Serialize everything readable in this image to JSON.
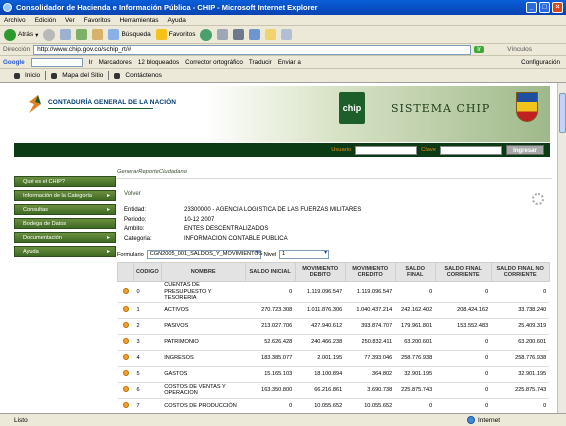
{
  "window": {
    "title": "Consolidador de Hacienda e Información Pública - CHIP - Microsoft Internet Explorer"
  },
  "menu": [
    "Archivo",
    "Edición",
    "Ver",
    "Favoritos",
    "Herramientas",
    "Ayuda"
  ],
  "toolbar": {
    "back": "Atrás",
    "search": "Búsqueda",
    "favorites": "Favoritos"
  },
  "address": {
    "label": "Dirección",
    "url": "http://www.chip.gov.co/schip_rt/#",
    "go": "Ir",
    "links": "Vínculos"
  },
  "googlebar": {
    "label": "Google",
    "go": "Ir",
    "bookmarks": "Marcadores",
    "blocked": "12 bloqueados",
    "spell": "Corrector ortográfico",
    "translate": "Traducir",
    "send": "Enviar a",
    "settings": "Configuración"
  },
  "sitelinks": [
    "Inicio",
    "Mapa del Sitio",
    "Contáctenos"
  ],
  "header": {
    "org": "CONTADURÍA GENERAL DE LA NACIÓN",
    "chip": "chip",
    "system": "SISTEMA CHIP"
  },
  "login": {
    "user_label": "Usuario",
    "key_label": "Clave",
    "button": "Ingresar"
  },
  "sidebar": [
    "Qué es el CHIP?",
    "Información de la Categoría",
    "Consultas",
    "Bodega de Datos",
    "Documentación",
    "Ayuda"
  ],
  "main": {
    "breadcrumb": "GenerarReporteCiudadano",
    "back": "Volver",
    "info": [
      {
        "k": "Entidad:",
        "v": "23300000 - AGENCIA LOGISTICA DE LAS FUERZAS MILITARES"
      },
      {
        "k": "Periodo:",
        "v": "10-12 2007"
      },
      {
        "k": "Ambito:",
        "v": "ENTES DESCENTRALIZADOS"
      },
      {
        "k": "Categoria:",
        "v": "INFORMACION CONTABLE PUBLICA"
      }
    ],
    "form_label": "Formulario",
    "form_value": "CGN2005_001_SALDOS_Y_MOVIMIENTOS",
    "level_label": "Nivel",
    "level_value": "1",
    "columns": [
      "CODIGO",
      "NOMBRE",
      "SALDO INICIAL",
      "MOVIMIENTO DEBITO",
      "MOVIMIENTO CREDITO",
      "SALDO FINAL",
      "SALDO FINAL CORRIENTE",
      "SALDO FINAL NO CORRIENTE"
    ],
    "rows": [
      [
        "0",
        "CUENTAS DE PRESUPUESTO Y TESORERIA",
        "0",
        "1.119.096.547",
        "1.119.096.547",
        "0",
        "0",
        "0"
      ],
      [
        "1",
        "ACTIVOS",
        "270.723.308",
        "1.011.876.306",
        "1.040.437.214",
        "242.162.402",
        "208.424.162",
        "33.738.240"
      ],
      [
        "2",
        "PASIVOS",
        "213.027.706",
        "427.940.612",
        "393.874.707",
        "179.961.801",
        "153.552.483",
        "25.409.319"
      ],
      [
        "3",
        "PATRIMONIO",
        "52.626.428",
        "240.466.238",
        "250.832.411",
        "63.200.601",
        "0",
        "63.200.601"
      ],
      [
        "4",
        "INGRESOS",
        "183.385.077",
        "2.001.195",
        "77.393.046",
        "258.776.938",
        "0",
        "258.776.938"
      ],
      [
        "5",
        "GASTOS",
        "15.165.103",
        "18.100.894",
        "364.802",
        "32.901.195",
        "0",
        "32.901.195"
      ],
      [
        "6",
        "COSTOS DE VENTAS Y OPERACION",
        "163.350.800",
        "66.216.861",
        "3.690.738",
        "225.875.743",
        "0",
        "225.875.743"
      ],
      [
        "7",
        "COSTOS DE PRODUCCIÓN",
        "0",
        "10.055.652",
        "10.055.652",
        "0",
        "0",
        "0"
      ]
    ]
  },
  "status": {
    "left": "Listo",
    "zone": "Internet"
  },
  "colors": {
    "titlebar": "#0a5fd8",
    "sidebar": "#4e7a2e",
    "login": "#0b3b14",
    "bullet": "#f4a12a"
  }
}
